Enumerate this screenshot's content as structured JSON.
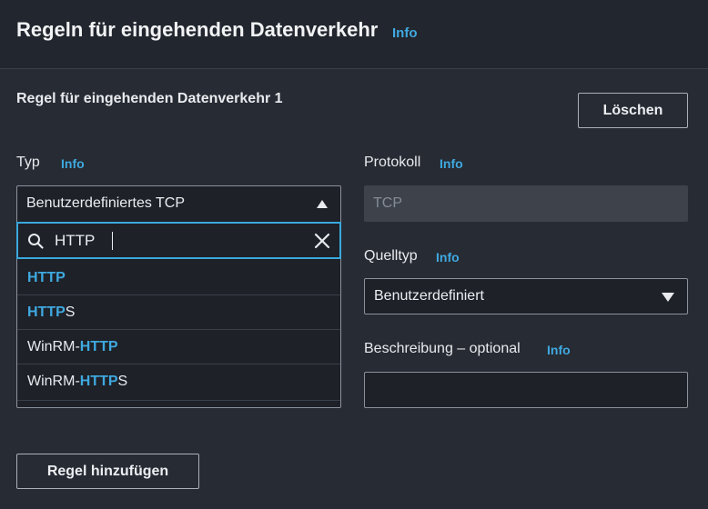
{
  "header": {
    "title": "Regeln für eingehenden Datenverkehr",
    "info": "Info"
  },
  "rule": {
    "title": "Regel für eingehenden Datenverkehr 1",
    "delete_label": "Löschen"
  },
  "typ": {
    "label": "Typ",
    "info": "Info",
    "selected": "Benutzerdefiniertes TCP",
    "search_value": "HTTP",
    "options": [
      {
        "match": "HTTP",
        "prefix": "",
        "suffix": ""
      },
      {
        "match": "HTTP",
        "prefix": "",
        "suffix": "S"
      },
      {
        "match": "HTTP",
        "prefix": "WinRM-",
        "suffix": ""
      },
      {
        "match": "HTTP",
        "prefix": "WinRM-",
        "suffix": "S"
      }
    ]
  },
  "protokoll": {
    "label": "Protokoll",
    "info": "Info",
    "value": "TCP"
  },
  "quelltyp": {
    "label": "Quelltyp",
    "info": "Info",
    "selected": "Benutzerdefiniert"
  },
  "beschreibung": {
    "label": "Beschreibung – optional",
    "info": "Info",
    "value": ""
  },
  "add_rule_label": "Regel hinzufügen",
  "colors": {
    "background": "#272b33",
    "header_bg": "#22262e",
    "accent": "#3fa9e0",
    "focus_border": "#3aa9dd"
  }
}
